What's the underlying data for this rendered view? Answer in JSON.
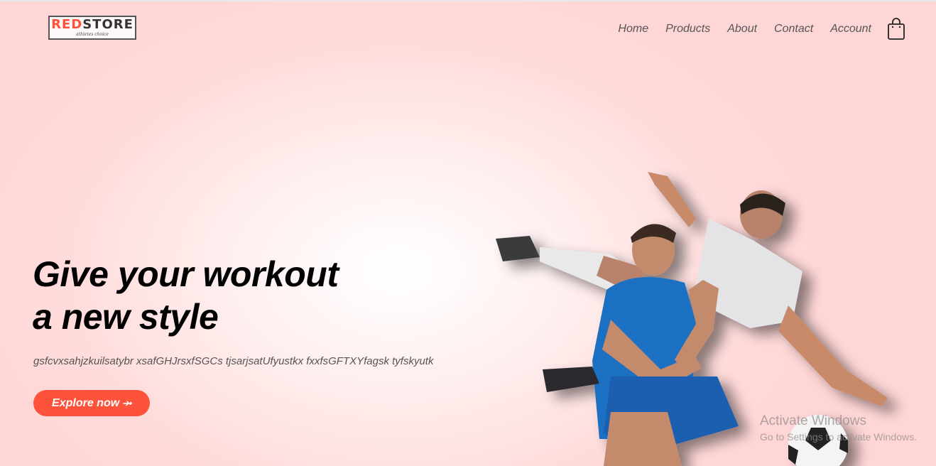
{
  "logo": {
    "brand_red": "RED",
    "brand_dark": "STORE",
    "tagline": "athletes choice"
  },
  "nav": {
    "items": [
      {
        "label": "Home"
      },
      {
        "label": "Products"
      },
      {
        "label": "About"
      },
      {
        "label": "Contact"
      },
      {
        "label": "Account"
      }
    ],
    "cart_icon": "shopping-bag-icon"
  },
  "hero": {
    "title_line1": "Give your workout",
    "title_line2": "a new style",
    "description": "gsfcvxsahjzkuilsatybr xsafGHJrsxfSGCs tjsarjsatUfyustkx fxxfsGFTXYfagsk tyfskyutk",
    "button_label": "Explore now",
    "button_arrow": "⤞",
    "image": "footballers-image"
  },
  "watermark": {
    "title": "Activate Windows",
    "subtitle": "Go to Settings to activate Windows."
  },
  "colors": {
    "accent": "#ff523b",
    "background": "#ffd6d6",
    "text": "#000000"
  }
}
